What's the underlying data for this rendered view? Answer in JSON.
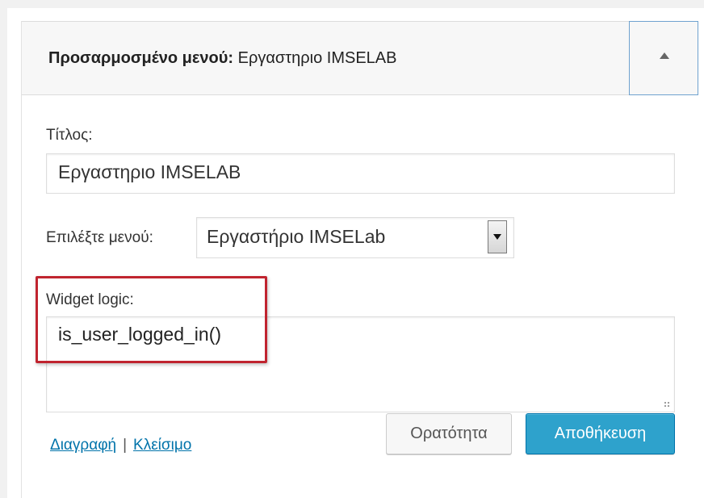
{
  "widget": {
    "title_prefix": "Προσαρμοσμένο μενού:",
    "title_name": "Εργαστηριο IMSELAB",
    "toggle_icon": "arrow-up-icon"
  },
  "form": {
    "title_label": "Τίτλος:",
    "title_value": "Εργαστηριο IMSELAB",
    "menu_label": "Επιλέξτε μενού:",
    "menu_selected": "Εργαστήριο IMSELab",
    "logic_label": "Widget logic:",
    "logic_value": "is_user_logged_in()"
  },
  "actions": {
    "delete_link": "Διαγραφή",
    "separator": "|",
    "close_link": "Κλείσιμο",
    "visibility_button": "Ορατότητα",
    "save_button": "Αποθήκευση"
  },
  "colors": {
    "primary_button": "#2ea2cc",
    "link": "#0073aa",
    "highlight_border": "#c0242f"
  }
}
